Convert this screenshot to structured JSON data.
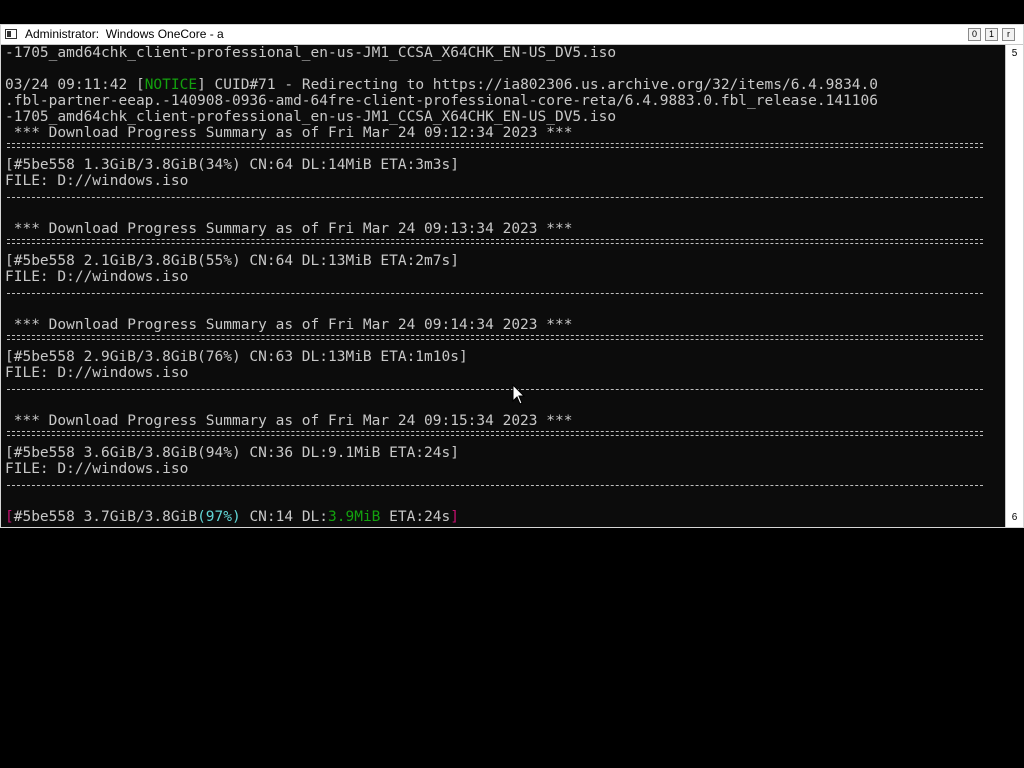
{
  "window": {
    "title": "Administrator:  Windows OneCore - a",
    "controls": {
      "minimize": "0",
      "maximize": "1",
      "close": "r"
    },
    "scroll_markers": {
      "top": "5",
      "bottom": "6"
    }
  },
  "console": {
    "line_1": "-1705_amd64chk_client-professional_en-us-JM1_CCSA_X64CHK_EN-US_DV5.iso",
    "notice_ts": "03/24 09:11:42 ",
    "notice_open": "[",
    "notice_tag": "NOTICE",
    "notice_rest": "] CUID#71 - Redirecting to https://ia802306.us.archive.org/32/items/6.4.9834.0",
    "line_url_2": ".fbl-partner-eeap.-140908-0936-amd-64fre-client-professional-core-reta/6.4.9883.0.fbl_release.141106",
    "line_url_3": "-1705_amd64chk_client-professional_en-us-JM1_CCSA_X64CHK_EN-US_DV5.iso",
    "summaries": [
      {
        "header": " *** Download Progress Summary as of Fri Mar 24 09:12:34 2023 ***",
        "progress": "[#5be558 1.3GiB/3.8GiB(34%) CN:64 DL:14MiB ETA:3m3s]",
        "file": "FILE: D://windows.iso"
      },
      {
        "header": " *** Download Progress Summary as of Fri Mar 24 09:13:34 2023 ***",
        "progress": "[#5be558 2.1GiB/3.8GiB(55%) CN:64 DL:13MiB ETA:2m7s]",
        "file": "FILE: D://windows.iso"
      },
      {
        "header": " *** Download Progress Summary as of Fri Mar 24 09:14:34 2023 ***",
        "progress": "[#5be558 2.9GiB/3.8GiB(76%) CN:63 DL:13MiB ETA:1m10s]",
        "file": "FILE: D://windows.iso"
      },
      {
        "header": " *** Download Progress Summary as of Fri Mar 24 09:15:34 2023 ***",
        "progress": "[#5be558 3.6GiB/3.8GiB(94%) CN:36 DL:9.1MiB ETA:24s]",
        "file": "FILE: D://windows.iso"
      }
    ],
    "live": {
      "open": "[",
      "id": "#5be558 3.7GiB/3.8GiB",
      "pct": "(97%)",
      "cn": " CN:14 DL:",
      "dl": "3.9MiB",
      "eta": " ETA:24s",
      "close": "]"
    }
  },
  "colors": {
    "background": "#0c0c0c",
    "text": "#c8c8c8",
    "notice": "#13a10e",
    "live_dl": "#13a10e",
    "live_pct": "#61d6d6",
    "live_bracket": "#c50f6f"
  },
  "icons": [
    "system-menu-icon",
    "mouse-cursor-icon"
  ]
}
